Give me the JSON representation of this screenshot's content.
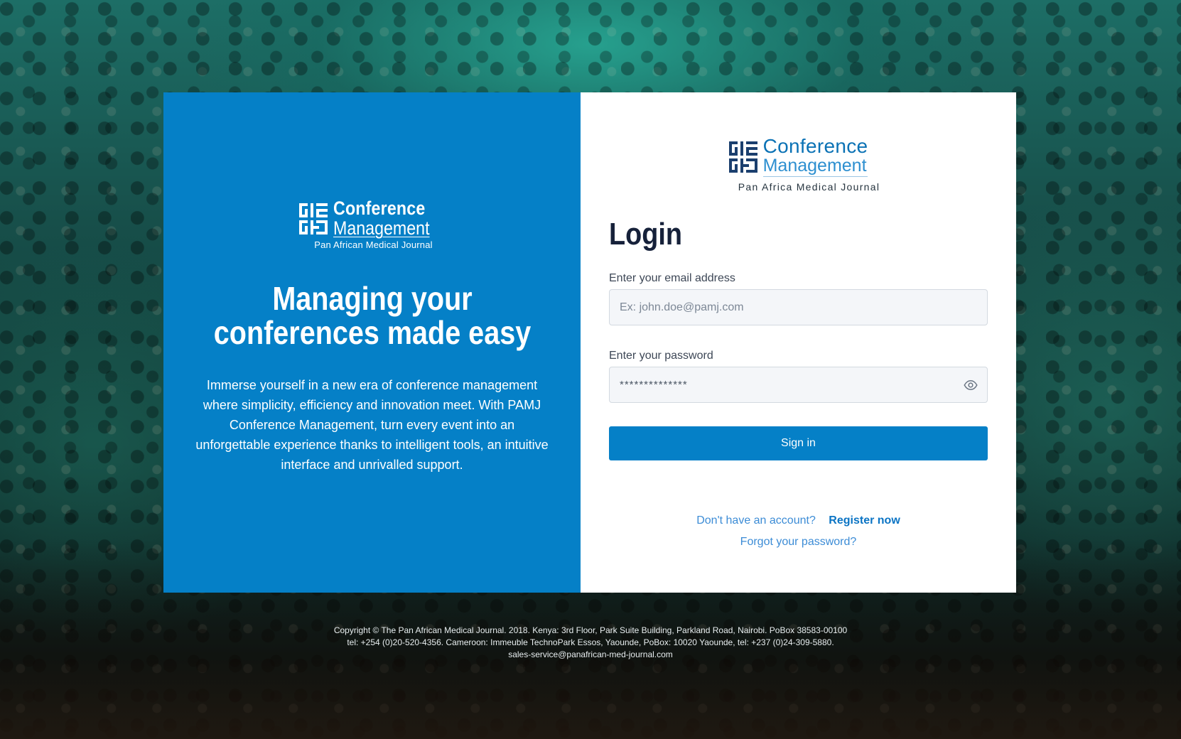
{
  "left_panel": {
    "logo": {
      "line1": "Conference",
      "line2": "Management",
      "subtitle": "Pan African Medical Journal"
    },
    "headline_line1": "Managing your",
    "headline_line2": "conferences made easy",
    "description": "Immerse yourself in a new era of conference management where simplicity, efficiency and innovation meet. With PAMJ Conference Management, turn every event into an unforgettable experience thanks to intelligent tools, an intuitive interface and unrivalled support."
  },
  "right_panel": {
    "logo": {
      "line1": "Conference",
      "line2": "Management",
      "subtitle": "Pan Africa Medical Journal"
    },
    "title": "Login",
    "email": {
      "label": "Enter your email address",
      "placeholder": "Ex: john.doe@pamj.com",
      "value": ""
    },
    "password": {
      "label": "Enter your password",
      "masked_value": "**************",
      "toggle_icon": "eye-icon"
    },
    "sign_in_label": "Sign in",
    "register_question": "Don't have an account?",
    "register_link": "Register now",
    "forgot_link": "Forgot your password?"
  },
  "footer": {
    "line1": "Copyright © The Pan African Medical Journal. 2018. Kenya: 3rd Floor, Park Suite Building, Parkland Road, Nairobi. PoBox 38583-00100",
    "line2": "tel: +254 (0)20-520-4356. Cameroon: Immeuble TechnoPark Essos, Yaounde, PoBox: 10020 Yaounde, tel: +237 (0)24-309-5880.",
    "line3": "sales-service@panafrican-med-journal.com"
  },
  "colors": {
    "primary_blue": "#0580c7",
    "title_dark": "#16213a",
    "link_blue": "#3c8cd6"
  }
}
